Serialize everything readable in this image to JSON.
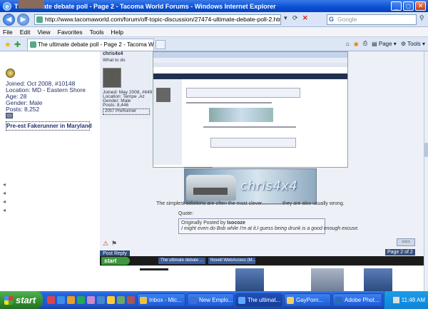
{
  "window": {
    "title": "The ultimate debate poll - Page 2 - Tacoma World Forums - Windows Internet Explorer"
  },
  "address": {
    "url": "http://www.tacomaworld.com/forum/off-topic-discussion/27474-ultimate-debate-poll-2.html",
    "search_placeholder": "Google"
  },
  "menu": {
    "items": [
      "File",
      "Edit",
      "View",
      "Favorites",
      "Tools",
      "Help"
    ]
  },
  "tabs": {
    "active_tab": "The ultimate debate poll - Page 2 - Tacoma World For...",
    "page_label": "Page",
    "tools_label": "Tools"
  },
  "left_user": {
    "joined": "Joined: Oct 2008, #10148",
    "location": "Location: MD - Eastern Shore",
    "age": "Age: 28",
    "gender": "Gender: Male",
    "posts": "Posts: 8,252",
    "title_badge": "Pre-est Fakerunner in Maryland"
  },
  "nested_user": {
    "name": "chris4x4",
    "subtitle": "What to do",
    "joined": "Joined: May 2008, #6497",
    "location": "Location: Tempe ,Az",
    "gender": "Gender: Male",
    "posts": "Posts: 8,446",
    "badge": "2007 PreRunner"
  },
  "post": {
    "signature_text": "chris4x4",
    "simplest_text": "The simplest solutions are often the most clever...............they are also usually wrong.",
    "quote_label": "Quote:",
    "quote_by_prefix": "Originally Posted by",
    "quote_author": "Isocoze",
    "quote_body": "I might even do Bob while I'm at it.I guess being drunk is a good enough excuse.",
    "reply_label": "Post Reply",
    "pagination": "Page 2 of 2"
  },
  "nested_taskbar": {
    "start_label": "start",
    "items": [
      "The ultimate debate ...",
      "Novell WebAccess (M..."
    ]
  },
  "taskbar": {
    "start_label": "start",
    "tasks": [
      "Inbox - Mic...",
      "New Emplo...",
      "The ultimat...",
      "GayPorn...",
      "Adobe Phot..."
    ],
    "clock": "11:48 AM"
  }
}
